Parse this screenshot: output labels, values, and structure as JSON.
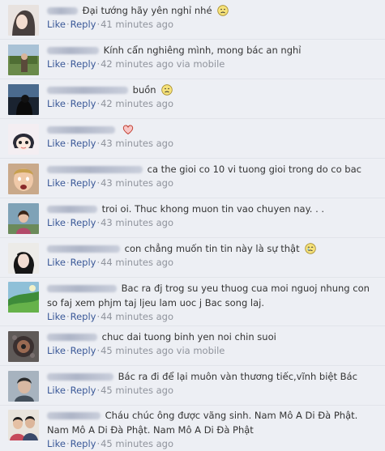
{
  "actions": {
    "like": "Like",
    "reply": "Reply",
    "separator": "·"
  },
  "comments": [
    {
      "text": "Đại tướng hãy yên nghỉ nhé",
      "emoji": "frown-emoji",
      "time": "41 minutes ago",
      "via": ""
    },
    {
      "text": "Kính cẩn nghiêng mình, mong bác an nghỉ",
      "emoji": "",
      "time": "42 minutes ago",
      "via": "via mobile"
    },
    {
      "text": "buồn",
      "emoji": "frown-emoji",
      "time": "42 minutes ago",
      "via": ""
    },
    {
      "text": "",
      "emoji": "heart-emoji",
      "time": "43 minutes ago",
      "via": ""
    },
    {
      "text": "ca the gioi co 10 vi tuong gioi trong do co bac",
      "emoji": "",
      "time": "43 minutes ago",
      "via": ""
    },
    {
      "text": "troi oi. Thuc khong muon tin vao chuyen nay. . .",
      "emoji": "",
      "time": "43 minutes ago",
      "via": ""
    },
    {
      "text": "con chẳng muốn tin tin này là sự thật",
      "emoji": "cry-emoji",
      "time": "44 minutes ago",
      "via": ""
    },
    {
      "text": "Bac ra đj trog su yeu thuog cua moi nguoj nhung con so faj xem phjm taj ljeu lam uoc j Bac song laj.",
      "emoji": "",
      "time": "44 minutes ago",
      "via": ""
    },
    {
      "text": "chuc dai tuong binh yen noi chin suoi",
      "emoji": "",
      "time": "45 minutes ago",
      "via": "via mobile"
    },
    {
      "text": "Bác ra đi để lại muôn vàn thương tiếc,vĩnh biệt Bác",
      "emoji": "",
      "time": "45 minutes ago",
      "via": ""
    },
    {
      "text": "Cháu chúc ông được vãng sinh. Nam Mô A Di Đà Phật. Nam Mô A Di Đà Phật. Nam Mô A Di Đà Phật",
      "emoji": "",
      "time": "45 minutes ago",
      "via": ""
    }
  ]
}
